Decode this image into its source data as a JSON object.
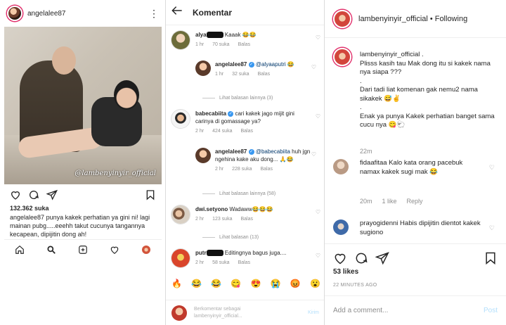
{
  "left_post": {
    "username": "angelalee87",
    "watermark": "@lambenyinyir_official",
    "likes": "132.362 suka",
    "caption_user": "angelalee87",
    "caption_text": " punya kakek perhatian ya gini ni! lagi mainan pubg.....eeehh takut cucunya tangannya kecapean, dipijitin dong ah!"
  },
  "middle": {
    "title": "Komentar",
    "comments": [
      {
        "user": "alya",
        "text": " Kaaak 😂😂",
        "time": "1 hr",
        "likes": "70 suka",
        "reply": "Balas"
      },
      {
        "user": "angelalee87",
        "mention": "@alyaaputri",
        "text": " 😂",
        "time": "1 hr",
        "likes": "32 suka",
        "reply": "Balas"
      },
      {
        "user": "babecabiita",
        "text": " cari kakek jago mijit gini carinya di gomassage ya?",
        "time": "2 hr",
        "likes": "424 suka",
        "reply": "Balas"
      },
      {
        "user": "angelalee87",
        "mention": "@babecabiita",
        "text": " huh jgn ngehina kake aku dong... 🙏😂",
        "time": "2 hr",
        "likes": "228 suka",
        "reply": "Balas"
      },
      {
        "user": "dwi.setyono",
        "text": " Wadaww😂😂😂",
        "time": "2 hr",
        "likes": "123 suka",
        "reply": "Balas"
      },
      {
        "user": "putr",
        "text": " Editingnya bagus juga....",
        "time": "2 hr",
        "likes": "58 suka",
        "reply": "Balas"
      }
    ],
    "more_replies": [
      "Lihat balasan lainnya (3)",
      "Lihat balasan lainnya (58)",
      "Lihat balasan (13)"
    ],
    "emojis": [
      "🔥",
      "😂",
      "😂",
      "😋",
      "😍",
      "😭",
      "😡",
      "😮"
    ],
    "input_placeholder_1": "Berkomentar sebagai",
    "input_placeholder_2": "lambenyinyir_official...",
    "send": "Kirim"
  },
  "right": {
    "username": "lambenyinyir_official",
    "following": "Following",
    "caption_user": "lambenyinyir_official",
    "caption_lines": [
      "Plisss kasih tau Mak dong itu si kakek nama nya siapa ???",
      ".",
      "Dari tadi liat komenan gak nemu2 nama sikakek 😅✌",
      ".",
      "Enak ya punya Kakek perhatian banget sama cucu nya 😋🐑"
    ],
    "caption_time": "22m",
    "comments": [
      {
        "user": "fidaafitaa",
        "text": " Kalo kata orang pacebuk namax kakek sugi mak 😂",
        "time": "20m",
        "likes": "1 like",
        "reply": "Reply"
      },
      {
        "user": "prayogidenni",
        "text": " Habis dipijitin dientot kakek sugiono",
        "time": "",
        "likes": "",
        "reply": ""
      }
    ],
    "likes": "53 likes",
    "time_ago": "22 MINUTES AGO",
    "add_comment": "Add a comment...",
    "post": "Post"
  }
}
